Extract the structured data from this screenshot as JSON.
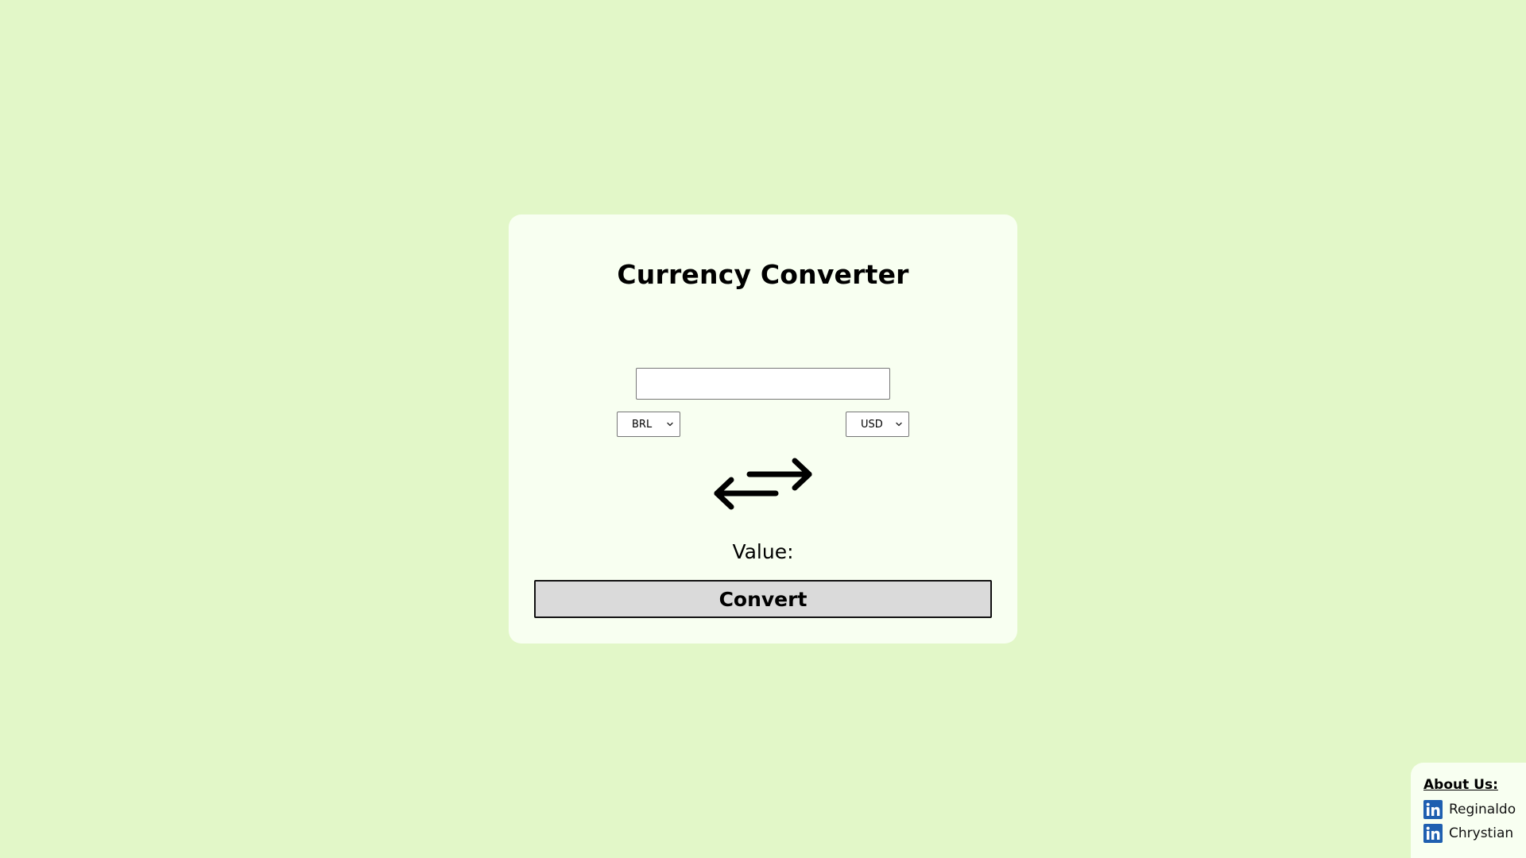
{
  "app": {
    "title": "Currency Converter"
  },
  "converter": {
    "amount_value": "",
    "amount_placeholder": "",
    "from_currency": "BRL",
    "to_currency": "USD",
    "swap_icon": "swap-arrows-icon",
    "value_label": "Value:",
    "convert_label": "Convert"
  },
  "about": {
    "title": "About Us:",
    "links": [
      {
        "icon": "linkedin-icon",
        "label": "Reginaldo"
      },
      {
        "icon": "linkedin-icon",
        "label": "Chrystian"
      }
    ]
  },
  "colors": {
    "background": "#e2f7c8",
    "card": "#f8fff1",
    "button": "#dadada",
    "linkedin": "#1f5fb0"
  }
}
